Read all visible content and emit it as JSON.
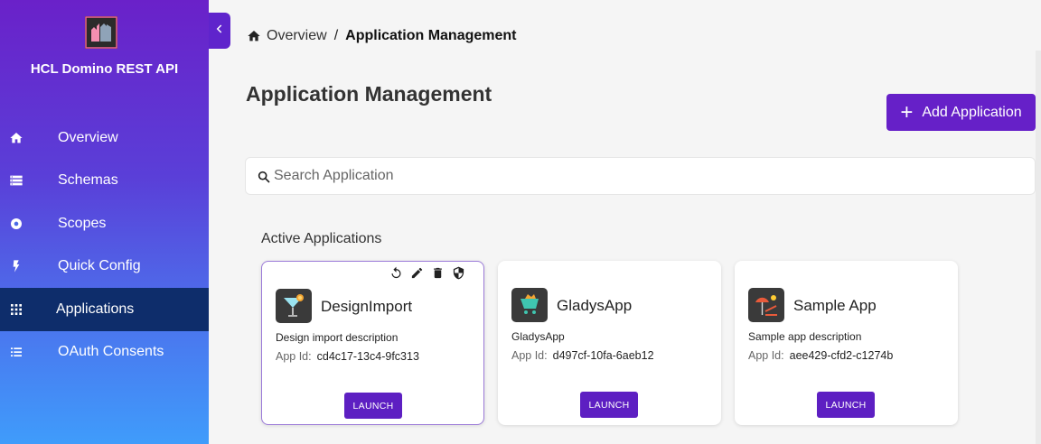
{
  "sidebar": {
    "app_title": "HCL Domino REST API",
    "items": [
      {
        "label": "Overview",
        "icon": "home-icon"
      },
      {
        "label": "Schemas",
        "icon": "schemas-icon"
      },
      {
        "label": "Scopes",
        "icon": "scopes-icon"
      },
      {
        "label": "Quick Config",
        "icon": "lightning-icon"
      },
      {
        "label": "Applications",
        "icon": "grid-icon",
        "active": true
      },
      {
        "label": "OAuth Consents",
        "icon": "list-icon"
      }
    ],
    "gradient_colors": [
      "#6a21c9",
      "#3f9cfb"
    ],
    "active_color": "#0e2d6b"
  },
  "breadcrumb": {
    "link": "Overview",
    "separator": "/",
    "current": "Application Management"
  },
  "page_title": "Application Management",
  "add_button": {
    "label": "Add Application"
  },
  "search": {
    "placeholder": "Search Application",
    "value": ""
  },
  "section_title": "Active Applications",
  "accent_color": "#6620c8",
  "apps": [
    {
      "name": "DesignImport",
      "description": "Design import description",
      "id_label": "App Id:",
      "id": "cd4c17-13c4-9fc313",
      "launch": "LAUNCH",
      "icon": "cocktail-icon"
    },
    {
      "name": "GladysApp",
      "description": "GladysApp",
      "id_label": "App Id:",
      "id": "d497cf-10fa-6aeb12",
      "launch": "LAUNCH",
      "icon": "cart-icon"
    },
    {
      "name": "Sample App",
      "description": "Sample app description",
      "id_label": "App Id:",
      "id": "aee429-cfd2-c1274b",
      "launch": "LAUNCH",
      "icon": "beach-icon"
    }
  ]
}
